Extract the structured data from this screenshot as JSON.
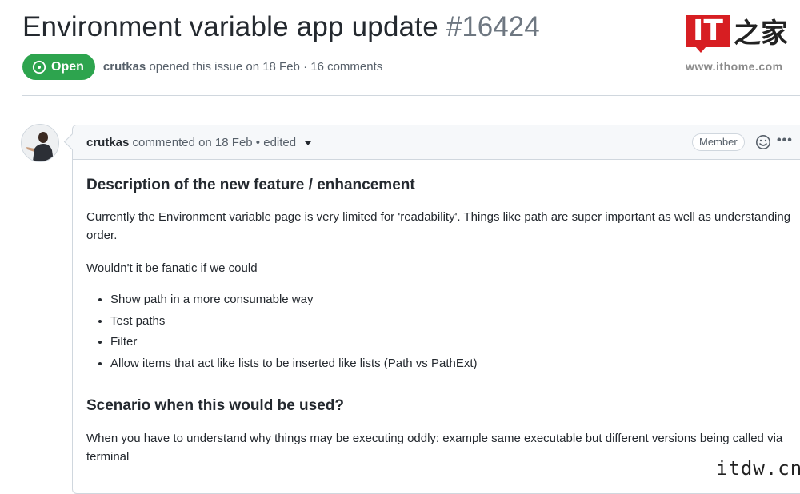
{
  "issue": {
    "title": "Environment variable app update",
    "number": "#16424",
    "state": "Open",
    "author": "crutkas",
    "meta": "opened this issue on 18 Feb · 16 comments"
  },
  "watermark": {
    "logo_it": "IT",
    "logo_zh": "之家",
    "url": "www.ithome.com",
    "corner": "itdw.cn"
  },
  "comment": {
    "author": "crutkas",
    "meta": "commented on 18 Feb • edited",
    "role_badge": "Member",
    "heading1": "Description of the new feature / enhancement",
    "para1": "Currently the Environment variable page is very limited for 'readability'. Things like path are super important as well as understanding order.",
    "para2": "Wouldn't it be fanatic if we could",
    "bullets": [
      "Show path in a more consumable way",
      "Test paths",
      "Filter",
      "Allow items that act like lists to be inserted like lists (Path vs PathExt)"
    ],
    "heading2": "Scenario when this would be used?",
    "para3": "When you have to understand why things may be executing oddly: example same executable but different versions being called via terminal"
  },
  "colors": {
    "open_green": "#2da44e",
    "text": "#24292f",
    "muted": "#57606a",
    "border": "#d0d7de",
    "brand_red": "#d71e22"
  },
  "icons": [
    "issue-open-icon",
    "caret-down-icon",
    "smiley-icon",
    "kebab-icon"
  ]
}
